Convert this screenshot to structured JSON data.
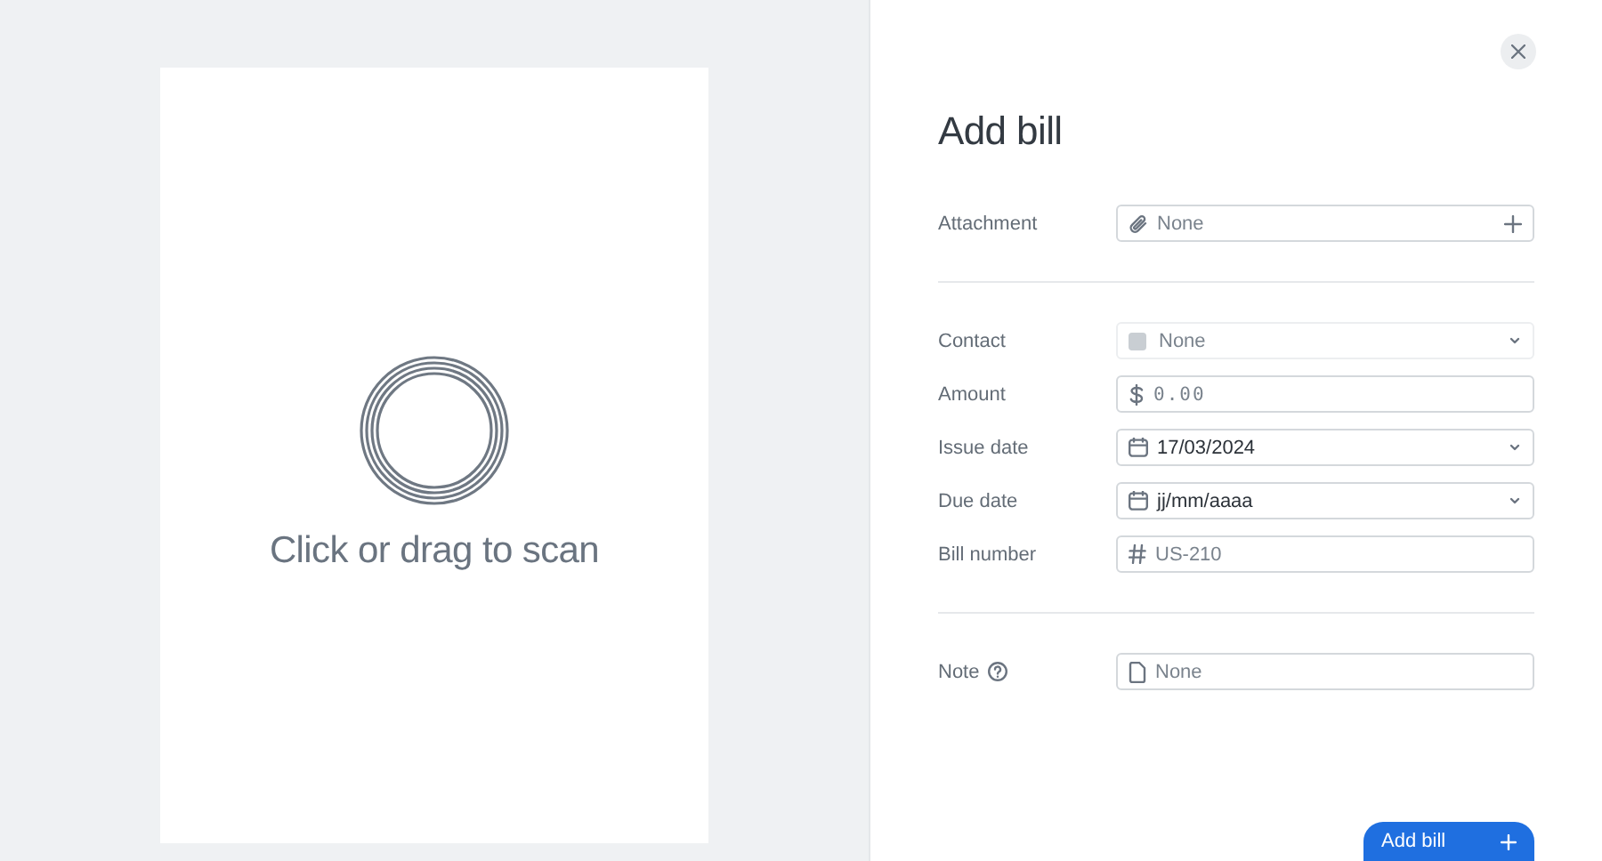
{
  "scanner": {
    "prompt": "Click or drag to scan"
  },
  "dialog": {
    "title": "Add bill",
    "sections": [
      {
        "fields": [
          {
            "label": "Attachment",
            "kind": "attachment",
            "placeholder": "None",
            "help": false
          }
        ]
      },
      {
        "fields": [
          {
            "label": "Contact",
            "kind": "select",
            "placeholder": "None",
            "help": false
          },
          {
            "label": "Amount",
            "kind": "money",
            "placeholder": "0.00",
            "help": false
          },
          {
            "label": "Issue date",
            "kind": "date",
            "value": "17/03/2024",
            "help": false
          },
          {
            "label": "Due date",
            "kind": "date",
            "value": "jj/mm/aaaa",
            "help": false
          },
          {
            "label": "Bill number",
            "kind": "number",
            "placeholder": "US-210",
            "help": false
          }
        ]
      },
      {
        "fields": [
          {
            "label": "Note",
            "kind": "note",
            "placeholder": "None",
            "help": true
          }
        ]
      }
    ],
    "submit": {
      "label": "Add bill"
    }
  }
}
